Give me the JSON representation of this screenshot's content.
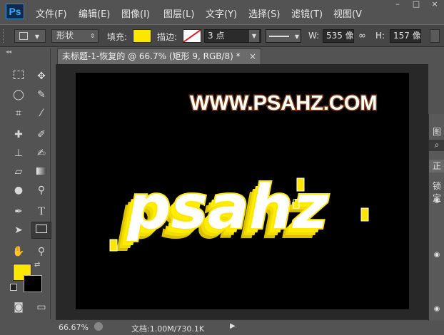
{
  "app": {
    "logo": "Ps"
  },
  "menu": [
    "文件(F)",
    "编辑(E)",
    "图像(I)",
    "图层(L)",
    "文字(Y)",
    "选择(S)",
    "滤镜(T)",
    "视图(V"
  ],
  "window_controls": [
    "–",
    "□",
    "×"
  ],
  "options": {
    "mode": "形状",
    "fill_label": "填充:",
    "stroke_label": "描边:",
    "stroke_size": "3 点",
    "w_label": "W:",
    "w_value": "535 像",
    "h_label": "H:",
    "h_value": "157 像",
    "fill_color": "#ffe600"
  },
  "document": {
    "tab_title": "未标题-1-恢复的 @ 66.7% (矩形 9, RGB/8) *",
    "close": "×",
    "watermark": "WWW.PSAHZ.COM",
    "art_text": "psahz"
  },
  "status": {
    "zoom": "66.67%",
    "doc_info": "文档:1.00M/730.1K"
  },
  "right_panel": {
    "tab1": "图层",
    "tab2": "正",
    "lock": "锁定"
  },
  "colors": {
    "foreground": "#ffe600",
    "background": "#000000"
  }
}
